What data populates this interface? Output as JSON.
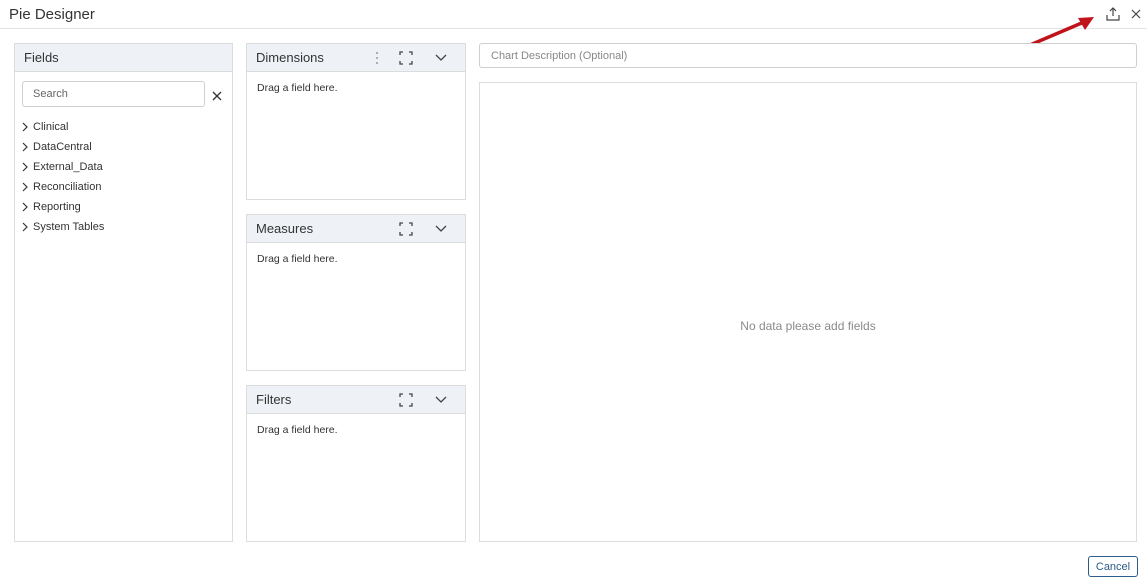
{
  "window": {
    "title": "Pie Designer",
    "export_icon": "upload-icon",
    "close_icon": "close-icon"
  },
  "fields_panel": {
    "title": "Fields",
    "search_placeholder": "Search",
    "clear_icon": "close-icon",
    "items": [
      {
        "label": "Clinical",
        "icon": "chevron-right-icon"
      },
      {
        "label": "DataCentral",
        "icon": "chevron-right-icon"
      },
      {
        "label": "External_Data",
        "icon": "chevron-right-icon"
      },
      {
        "label": "Reconciliation",
        "icon": "chevron-right-icon"
      },
      {
        "label": "Reporting",
        "icon": "chevron-right-icon"
      },
      {
        "label": "System Tables",
        "icon": "chevron-right-icon"
      }
    ]
  },
  "dimensions": {
    "title": "Dimensions",
    "hint": "Drag a field here.",
    "icons": [
      "more-vertical-icon",
      "expand-icon",
      "chevron-down-icon"
    ]
  },
  "measures": {
    "title": "Measures",
    "hint": "Drag a field here.",
    "icons": [
      "expand-icon",
      "chevron-down-icon"
    ]
  },
  "filters": {
    "title": "Filters",
    "hint": "Drag a field here.",
    "icons": [
      "expand-icon",
      "chevron-down-icon"
    ]
  },
  "chart": {
    "description_placeholder": "Chart Description (Optional)",
    "empty_message": "No data please add fields"
  },
  "footer": {
    "cancel_label": "Cancel"
  },
  "annotation": {
    "arrow_color": "#c0141a"
  }
}
